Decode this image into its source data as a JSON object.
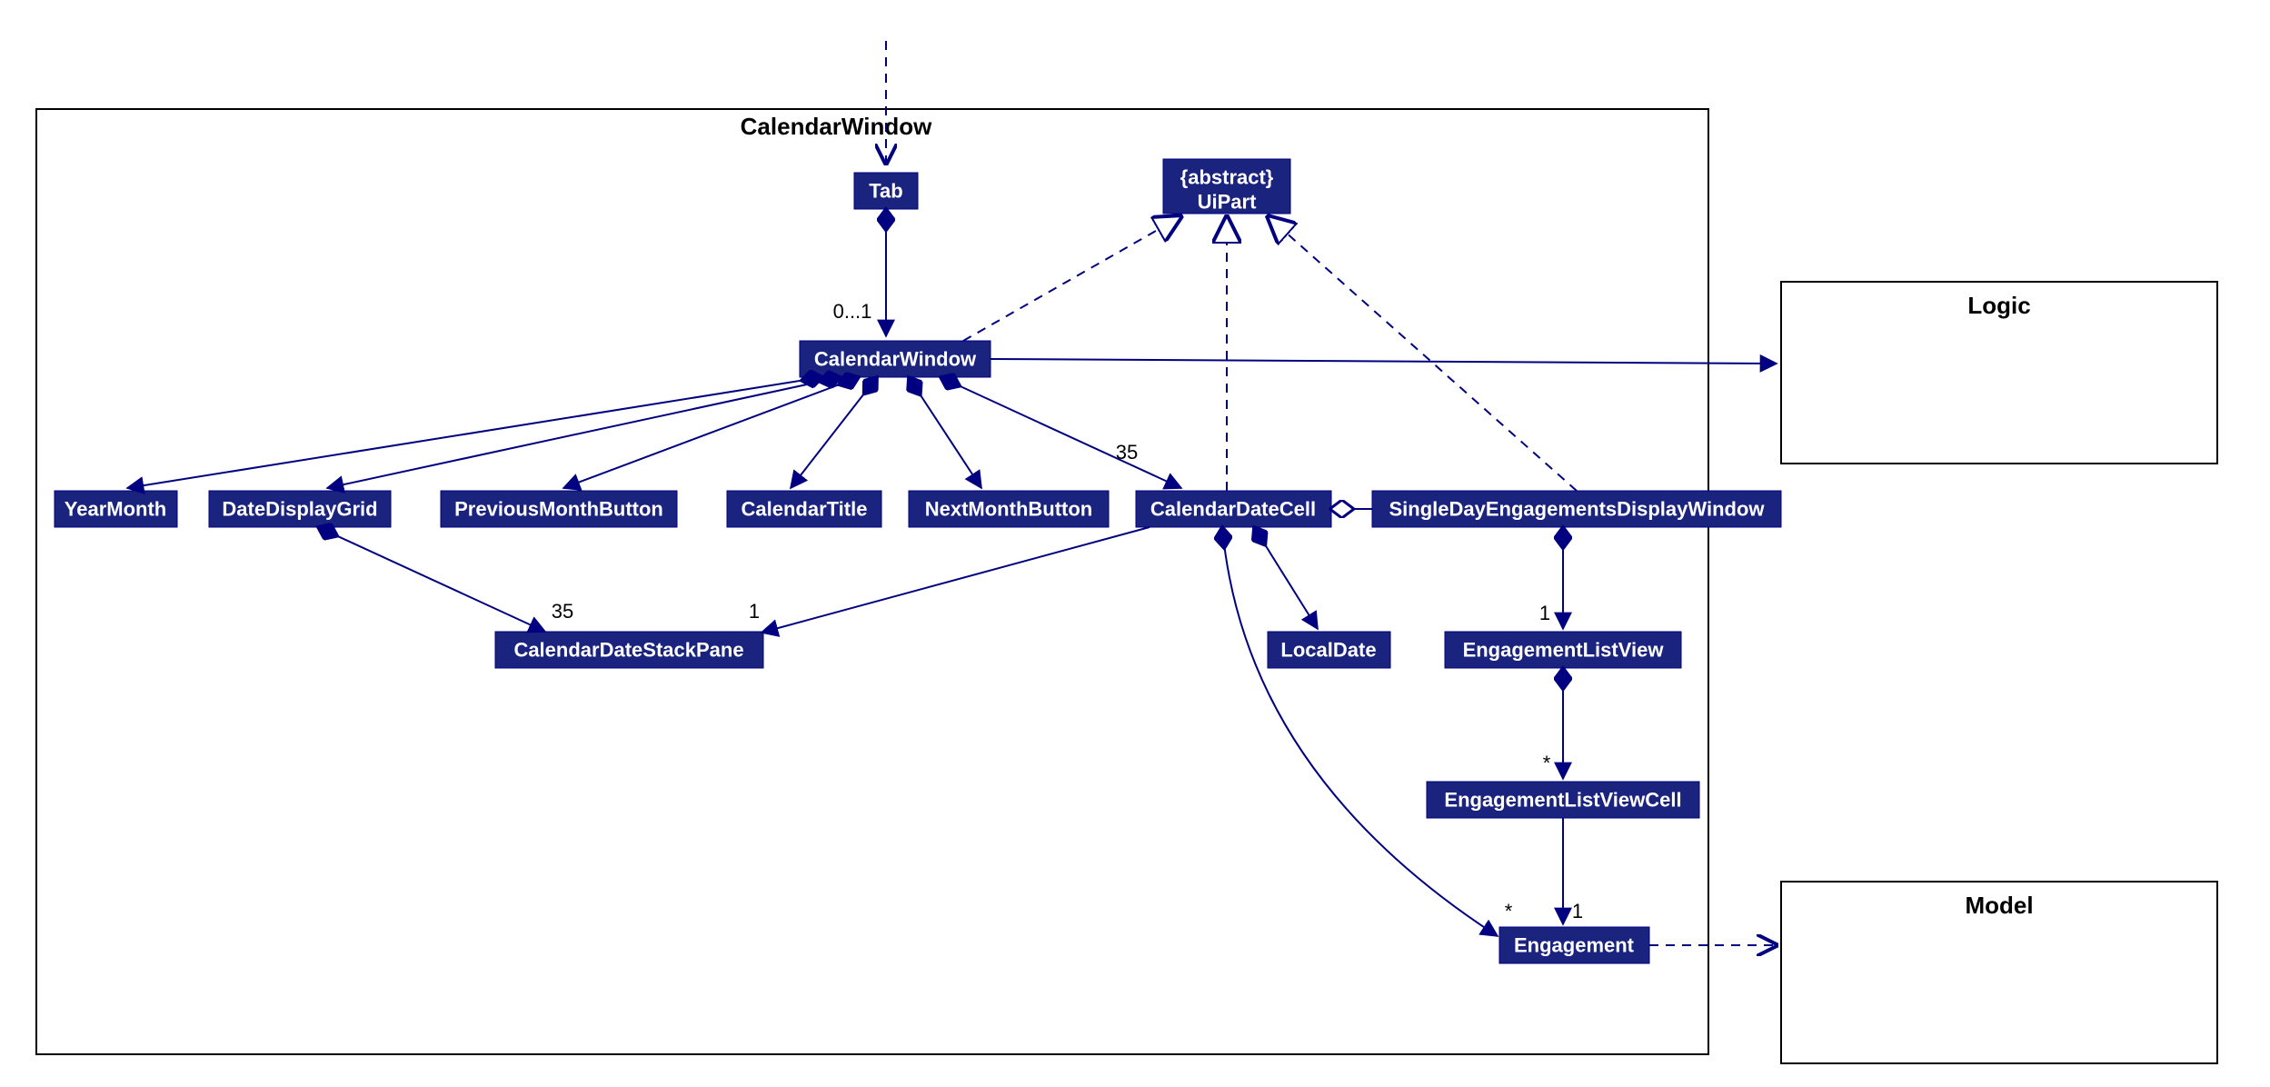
{
  "diagram": {
    "frameTitle": "CalendarWindow",
    "externalBoxes": {
      "logic": "Logic",
      "model": "Model"
    },
    "nodes": {
      "tab": "Tab",
      "uipart_l1": "{abstract}",
      "uipart_l2": "UiPart",
      "calendarWindow": "CalendarWindow",
      "yearMonth": "YearMonth",
      "dateDisplayGrid": "DateDisplayGrid",
      "previousMonthButton": "PreviousMonthButton",
      "calendarTitle": "CalendarTitle",
      "nextMonthButton": "NextMonthButton",
      "calendarDateCell": "CalendarDateCell",
      "singleDayEngagementsDisplayWindow": "SingleDayEngagementsDisplayWindow",
      "calendarDateStackPane": "CalendarDateStackPane",
      "localDate": "LocalDate",
      "engagementListView": "EngagementListView",
      "engagementListViewCell": "EngagementListViewCell",
      "engagement": "Engagement"
    },
    "labels": {
      "mult01": "0...1",
      "mult35a": "35",
      "mult35b": "35",
      "mult1a": "1",
      "mult1b": "1",
      "multStarA": "*",
      "multStarB": "*",
      "mult1c": "1"
    }
  }
}
